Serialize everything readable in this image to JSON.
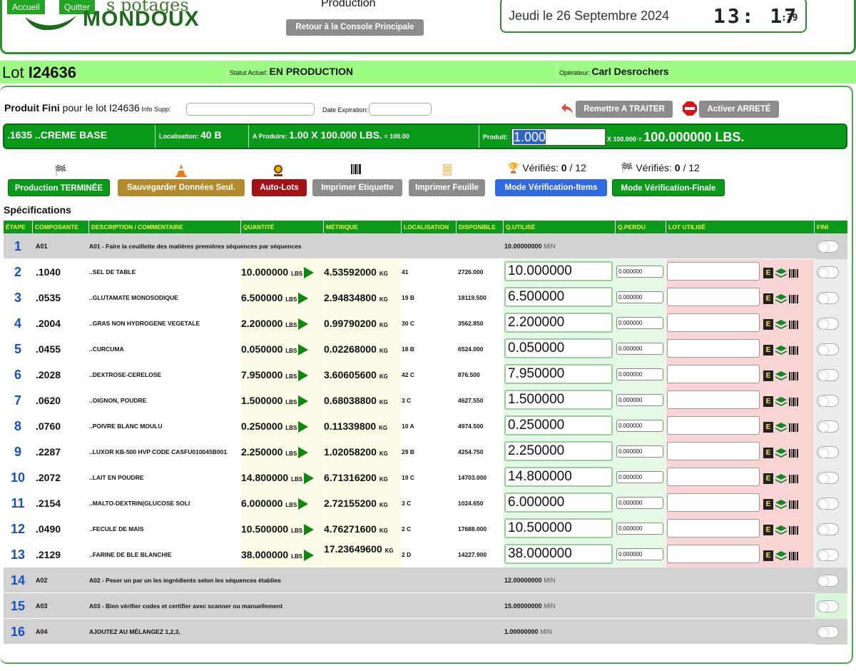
{
  "header": {
    "nav_accueil": "Accueil",
    "nav_quitter": "Quitter",
    "logo_top": "s potages",
    "logo_bottom": "MONDOUX",
    "title": "Production",
    "console_button": "Retour à la Console Principale",
    "date": "Jeudi le 26 Septembre 2024",
    "clock_hm": "13: 17",
    "clock_sec": ":39"
  },
  "lot": {
    "label": "Lot ",
    "number": "I24636",
    "status_label": "Statut Actuel: ",
    "status_value": "EN PRODUCTION",
    "operator_label": "Opérateur: ",
    "operator_value": "Carl Desrochers"
  },
  "product": {
    "prefix": "Produit Fini",
    "suffix": " pour le lot I24636",
    "info_label": " Info Supp:",
    "exp_label": "Date Expiration:",
    "btn_traiter": "Remettre A TRAITER",
    "btn_arrete": "Activer ARRETÉ",
    "code": ".1635 ..CREME BASE",
    "loc_label": "Localisation: ",
    "loc_value": "40 B",
    "aprod_label": "A Produire: ",
    "aprod_value": "1.00 X 100.000 LBS.",
    "aprod_small": " = 100.00",
    "produit_label": "Produit:",
    "produit_value": "1.000",
    "total_small": "X 100.000 = ",
    "total_value": "100.000000 LBS."
  },
  "actions": {
    "btn_terminee": "Production TERMINÉE",
    "btn_sauvegarder": "Sauvegarder Données Seul.",
    "btn_autolots": "Auto-Lots",
    "btn_etiquette": "Imprimer Etiquette",
    "btn_feuille": "Imprimer Feuille",
    "btn_verif_items": "Mode Vérification-Items",
    "btn_verif_finale": "Mode Vérification-Finale",
    "verif_label": "Vérifiés: ",
    "verif_count": "0",
    "verif_total": " / 12",
    "verif2_count": "0",
    "verif2_total": " / 12"
  },
  "spec_title": "Spécifications",
  "table": {
    "headers": [
      "ÉTAPE",
      "COMPOSANTE",
      "DESCRIPTION / COMMENTAIRE",
      "QUANTITÉ",
      "MÉTRIQUE",
      "LOCALISATION",
      "DISPONIBLE",
      "Q.UTILISÉ",
      "Q.PERDU",
      "LOT UTILISÉ",
      "FINI"
    ],
    "seq_rows": [
      {
        "etape": "1",
        "comp": "A01",
        "desc": "A01 - Faire la ceuillette des matières premières séquences par séquences",
        "qu": "10.00000000",
        "unit": " MIN"
      },
      {
        "etape": "14",
        "comp": "A02",
        "desc": "A02 - Peser un par un les ingrédients selon les séquences établies",
        "qu": "12.00000000",
        "unit": " MIN"
      },
      {
        "etape": "15",
        "comp": "A03",
        "desc": "A03 - Bien vérifier codes et certifier avec scanner ou manuellement",
        "qu": "15.00000000",
        "unit": " MIN"
      },
      {
        "etape": "16",
        "comp": "A04",
        "desc": "AJOUTEZ AU MÉLANGEZ 1,2,3,",
        "qu": "1.00000000",
        "unit": " MIN"
      }
    ],
    "ing_rows": [
      {
        "etape": "2",
        "comp": ".1040",
        "desc": "..SEL DE TABLE",
        "qty": "10.000000",
        "qty_unit": "LBS",
        "met": "4.53592000",
        "met_unit": "KG",
        "loc": "41",
        "dispo": "2726.000",
        "qu": "10.000000",
        "qp": "0.000000"
      },
      {
        "etape": "3",
        "comp": ".0535",
        "desc": "..GLUTAMATE MONOSODIQUE",
        "qty": "6.500000",
        "qty_unit": "LBS",
        "met": "2.94834800",
        "met_unit": "KG",
        "loc": "19 B",
        "dispo": "18119.500",
        "qu": "6.500000",
        "qp": "0.000000"
      },
      {
        "etape": "4",
        "comp": ".2004",
        "desc": "..GRAS NON HYDROGENE VEGETALE",
        "qty": "2.200000",
        "qty_unit": "LBS",
        "met": "0.99790200",
        "met_unit": "KG",
        "loc": "30 C",
        "dispo": "3562.850",
        "qu": "2.200000",
        "qp": "0.000000"
      },
      {
        "etape": "5",
        "comp": ".0455",
        "desc": "..CURCUMA",
        "qty": "0.050000",
        "qty_unit": "LBS",
        "met": "0.02268000",
        "met_unit": "KG",
        "loc": "18 B",
        "dispo": "6524.000",
        "qu": "0.050000",
        "qp": "0.000000"
      },
      {
        "etape": "6",
        "comp": ".2028",
        "desc": "..DEXTROSE-CERELOSE",
        "qty": "7.950000",
        "qty_unit": "LBS",
        "met": "3.60605600",
        "met_unit": "KG",
        "loc": "42 C",
        "dispo": "876.500",
        "qu": "7.950000",
        "qp": "0.000000"
      },
      {
        "etape": "7",
        "comp": ".0620",
        "desc": "..OIGNON, POUDRE",
        "qty": "1.500000",
        "qty_unit": "LBS",
        "met": "0.68038800",
        "met_unit": "KG",
        "loc": "3 C",
        "dispo": "4627.550",
        "qu": "1.500000",
        "qp": "0.000000"
      },
      {
        "etape": "8",
        "comp": ".0760",
        "desc": "..POIVRE BLANC MOULU",
        "qty": "0.250000",
        "qty_unit": "LBS",
        "met": "0.11339800",
        "met_unit": "KG",
        "loc": "10 A",
        "dispo": "4974.500",
        "qu": "0.250000",
        "qp": "0.000000"
      },
      {
        "etape": "9",
        "comp": ".2287",
        "desc": "..LUXOR KB-500 HVP CODE CASFU010045B001",
        "qty": "2.250000",
        "qty_unit": "LBS",
        "met": "1.02058200",
        "met_unit": "KG",
        "loc": "29 B",
        "dispo": "4254.750",
        "qu": "2.250000",
        "qp": "0.000000"
      },
      {
        "etape": "10",
        "comp": ".2072",
        "desc": "..LAIT EN POUDRE",
        "qty": "14.800000",
        "qty_unit": "LBS",
        "met": "6.71316200",
        "met_unit": "KG",
        "loc": "19 C",
        "dispo": "14703.000",
        "qu": "14.800000",
        "qp": "0.000000"
      },
      {
        "etape": "11",
        "comp": ".2154",
        "desc": "..MALTO-DEXTRIN(GLUCOSE SOLI",
        "qty": "6.000000",
        "qty_unit": "LBS",
        "met": "2.72155200",
        "met_unit": "KG",
        "loc": "3 C",
        "dispo": "1024.650",
        "qu": "6.000000",
        "qp": "0.000000"
      },
      {
        "etape": "12",
        "comp": ".0490",
        "desc": "..FECULE DE MAIS",
        "qty": "10.500000",
        "qty_unit": "LBS",
        "met": "4.76271600",
        "met_unit": "KG",
        "loc": "2 C",
        "dispo": "17688.000",
        "qu": "10.500000",
        "qp": "0.000000"
      },
      {
        "etape": "13",
        "comp": ".2129",
        "desc": "..FARINE DE BLE BLANCHIE",
        "qty": "38.000000",
        "qty_unit": "LBS",
        "met": "17.23649600",
        "met_unit": "KG",
        "loc": "2 D",
        "dispo": "14227.900",
        "qu": "38.000000",
        "qp": "0.000000"
      }
    ]
  },
  "colors": {
    "accent_green": "#0a9a19",
    "lot_bar": "#9bfb83",
    "etape_blue": "#1650c7",
    "header_text": "#f4f048"
  }
}
